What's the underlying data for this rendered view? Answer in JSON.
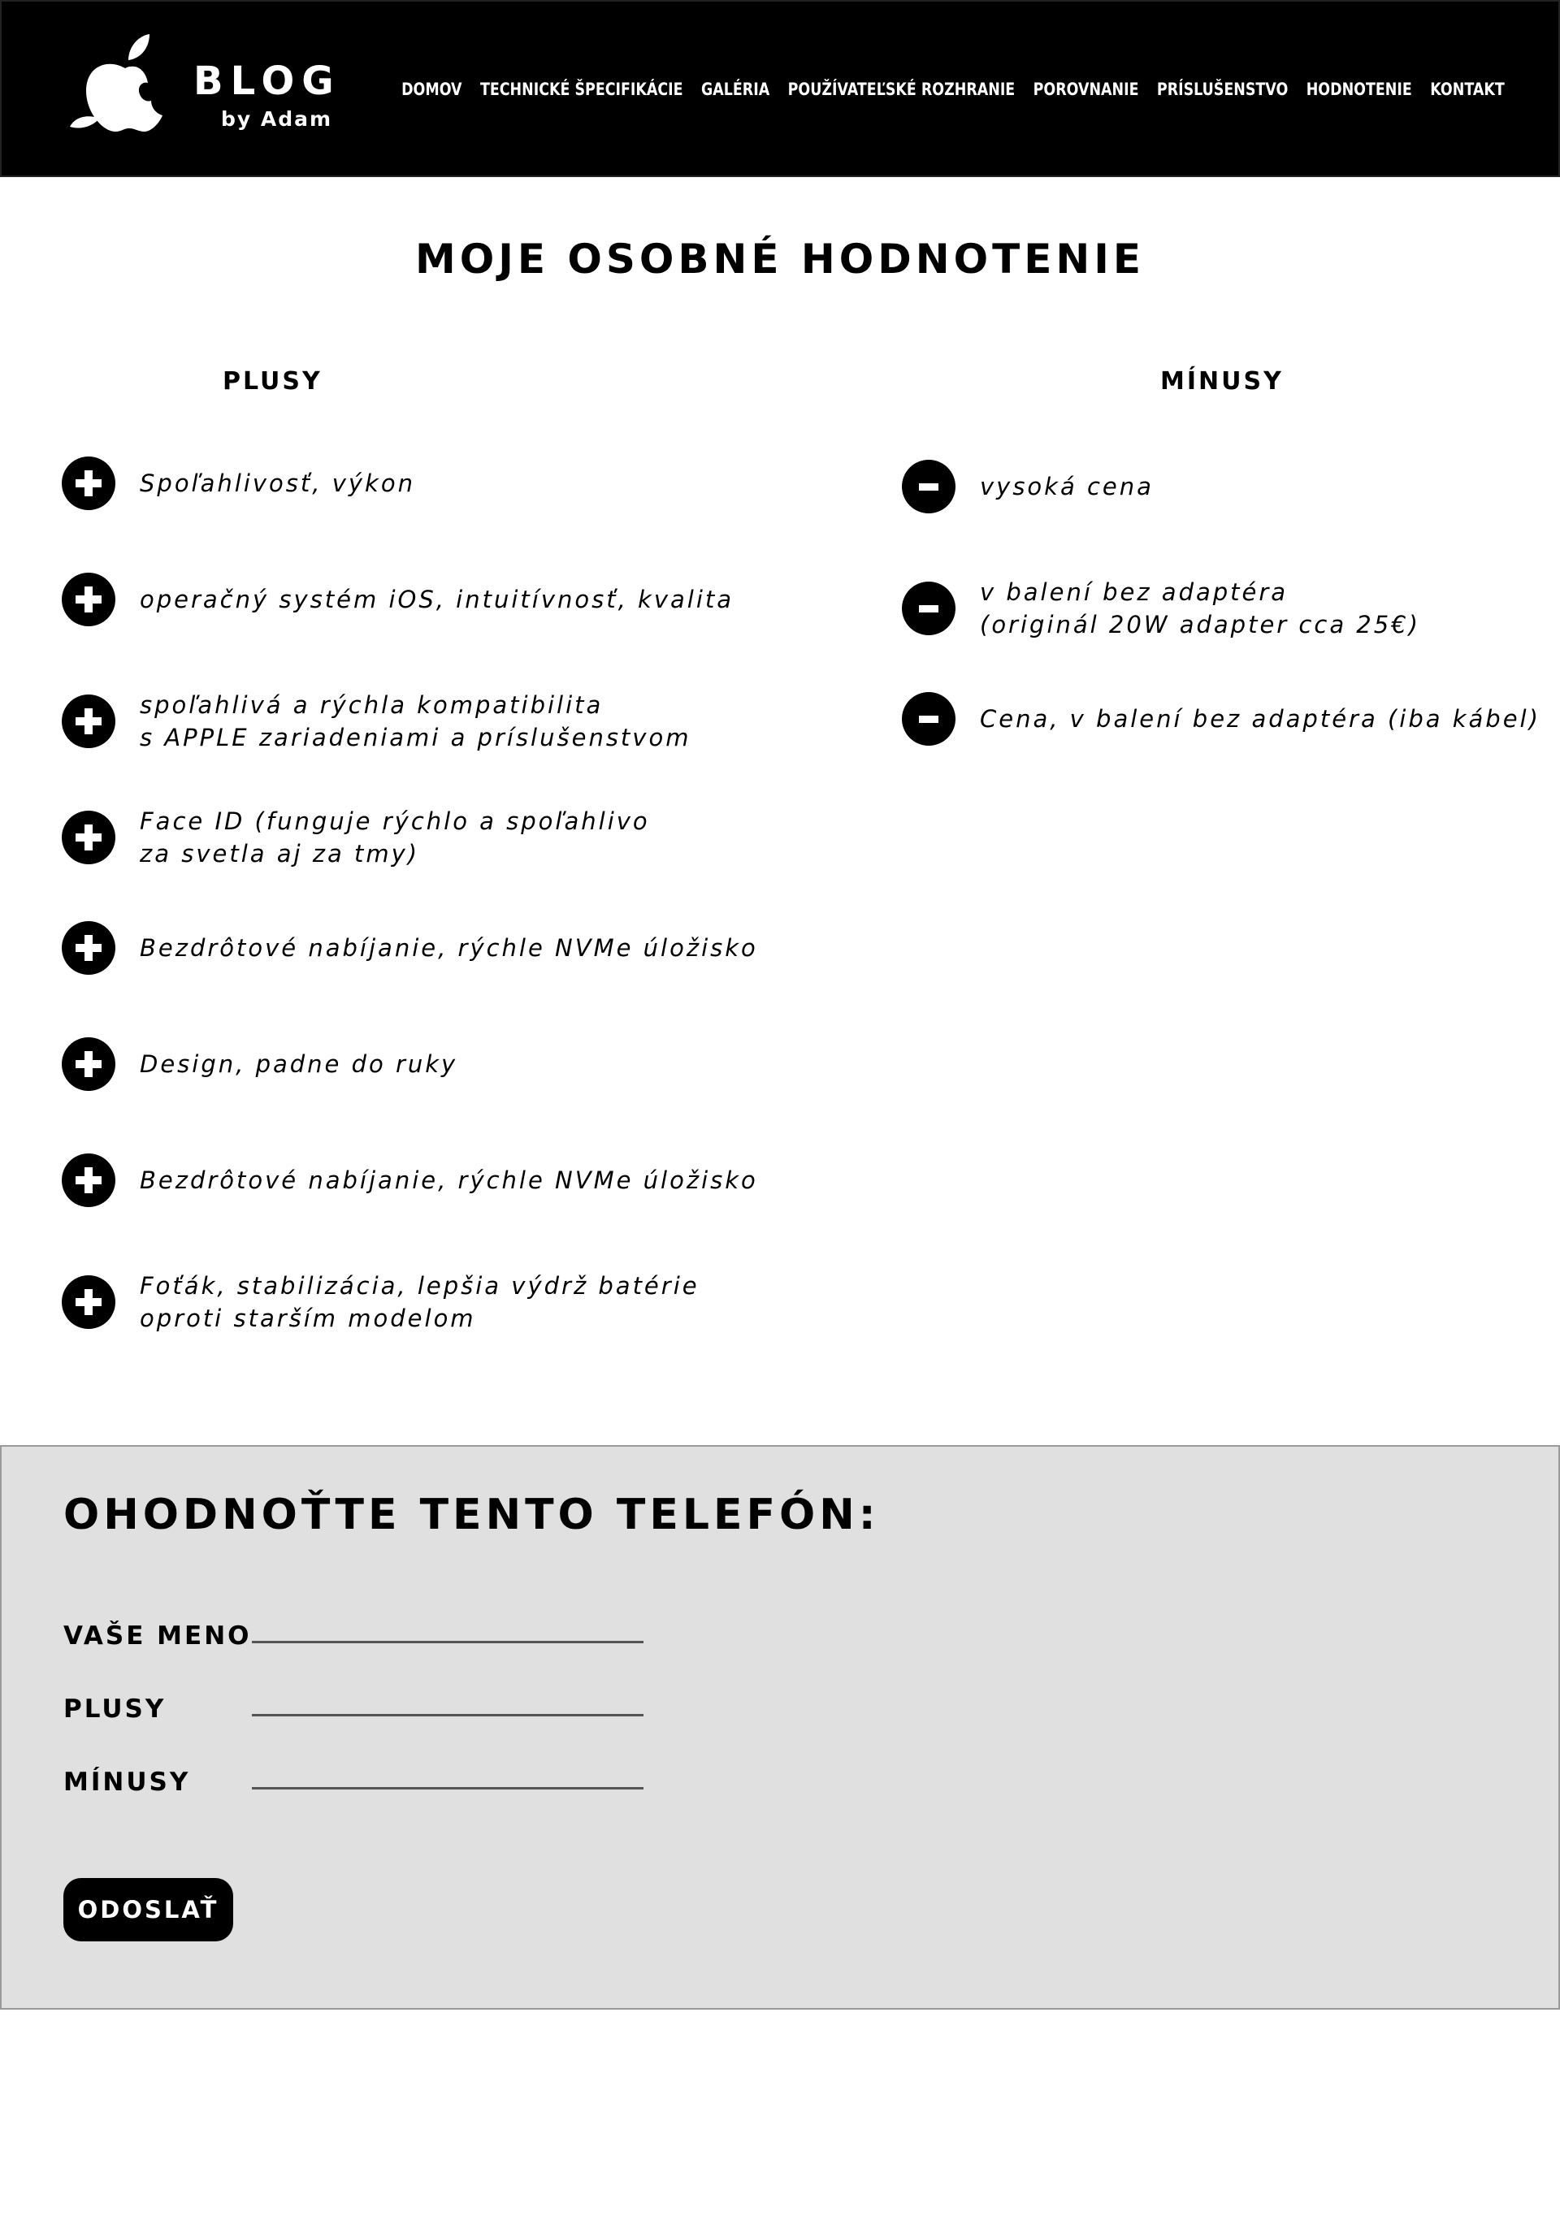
{
  "header": {
    "logo": {
      "title": "BLOG",
      "subtitle": "by Adam",
      "icon": "apple-icon"
    },
    "nav": [
      {
        "label": "DOMOV"
      },
      {
        "label": "TECHNICKÉ ŠPECIFIKÁCIE"
      },
      {
        "label": "GALÉRIA"
      },
      {
        "label": "POUŽÍVATEĽSKÉ ROZHRANIE"
      },
      {
        "label": "POROVNANIE"
      },
      {
        "label": "PRÍSLUŠENSTVO"
      },
      {
        "label": "HODNOTENIE"
      },
      {
        "label": "KONTAKT"
      }
    ]
  },
  "review": {
    "title": "MOJE OSOBNÉ HODNOTENIE",
    "pros_title": "PLUSY",
    "cons_title": "MÍNUSY",
    "pros": [
      "Spoľahlivosť, výkon",
      "operačný systém iOS, intuitívnosť, kvalita",
      "spoľahlivá a rýchla kompatibilita\ns APPLE zariadeniami a príslušenstvom",
      "Face ID (funguje rýchlo a spoľahlivo\nza svetla aj za tmy)",
      "Bezdrôtové nabíjanie, rýchle NVMe úložisko",
      "Design, padne do ruky",
      "Bezdrôtové nabíjanie, rýchle NVMe úložisko",
      "Foťák, stabilizácia, lepšia výdrž batérie\noproti starším modelom"
    ],
    "cons": [
      "vysoká cena",
      "v balení bez adaptéra\n(originál 20W adapter cca 25€)",
      "Cena, v balení bez adaptéra (iba kábel)"
    ]
  },
  "rating_form": {
    "title": "OHODNOŤTE TENTO TELEFÓN:",
    "name_label": "VAŠE MENO",
    "pros_label": "PLUSY",
    "cons_label": "MÍNUSY",
    "name_value": "",
    "pros_value": "",
    "cons_value": "",
    "submit_label": "ODOSLAŤ"
  },
  "colors": {
    "header_bg": "#000000",
    "form_bg": "#e0e0e0",
    "text": "#000000"
  }
}
